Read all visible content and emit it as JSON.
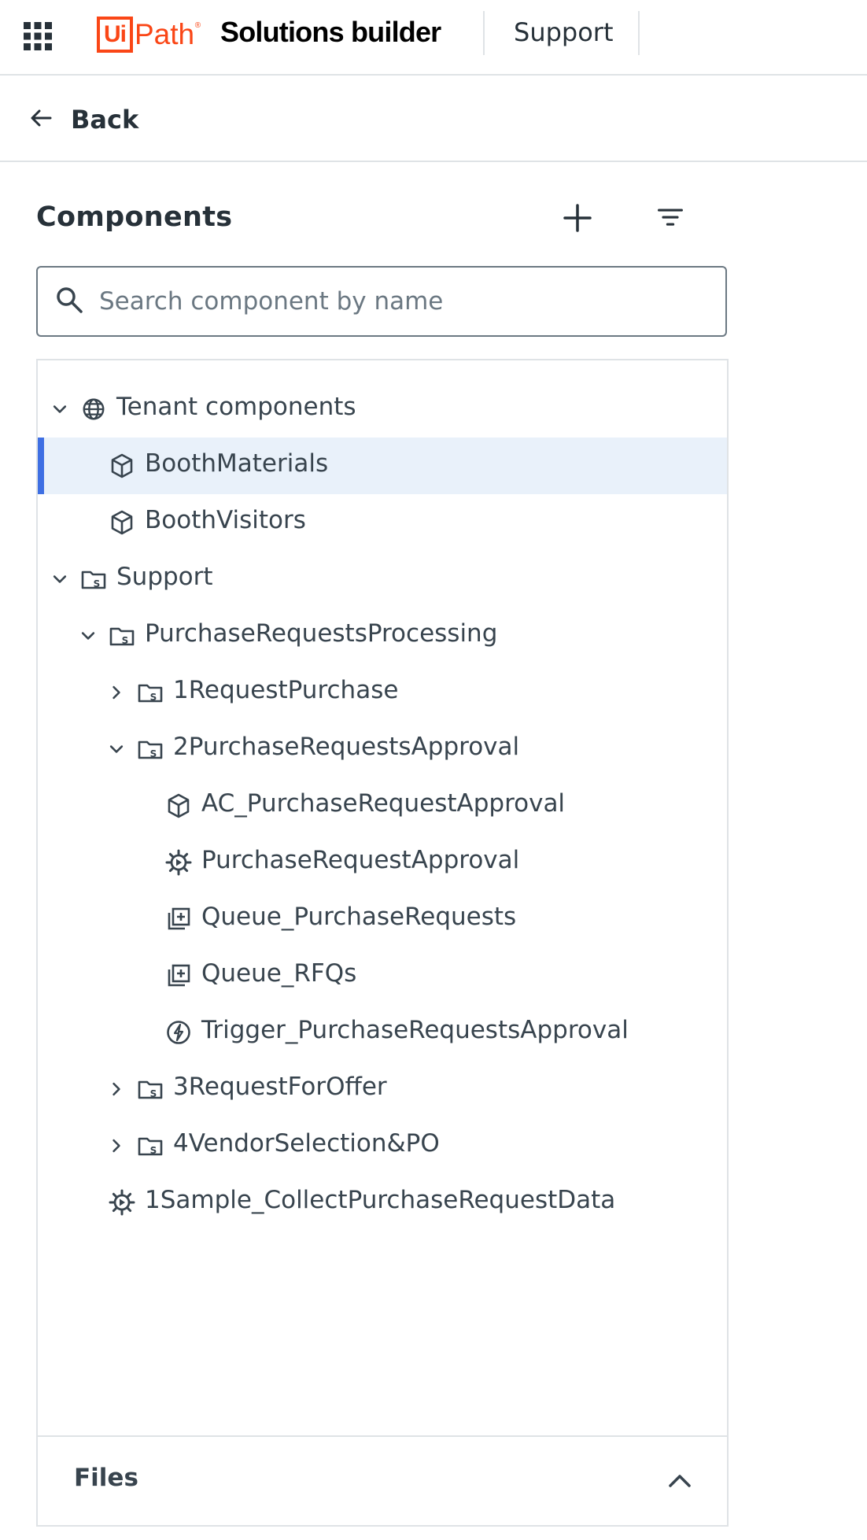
{
  "header": {
    "logo_mark": "Ui",
    "logo_word": "Path",
    "logo_reg": "®",
    "title": "Solutions builder",
    "context": "Support",
    "apps_icon": "apps-grid-icon"
  },
  "nav": {
    "back_label": "Back",
    "back_icon": "arrow-left-icon"
  },
  "panel": {
    "title": "Components",
    "add_icon": "plus-icon",
    "filter_icon": "filter-icon",
    "search": {
      "placeholder": "Search component by name",
      "value": "",
      "icon": "search-icon"
    }
  },
  "tree": [
    {
      "label": "Tenant components",
      "icon": "globe-icon",
      "chevron": "down",
      "level": 0
    },
    {
      "label": "BoothMaterials",
      "icon": "cube-icon",
      "chevron": "none",
      "level": 1,
      "selected": true
    },
    {
      "label": "BoothVisitors",
      "icon": "cube-icon",
      "chevron": "none",
      "level": 1
    },
    {
      "label": "Support",
      "icon": "solution-folder-icon",
      "chevron": "down",
      "level": 0
    },
    {
      "label": "PurchaseRequestsProcessing",
      "icon": "solution-folder-icon",
      "chevron": "down",
      "level": 1
    },
    {
      "label": "1RequestPurchase",
      "icon": "solution-folder-icon",
      "chevron": "right",
      "level": 2
    },
    {
      "label": "2PurchaseRequestsApproval",
      "icon": "solution-folder-icon",
      "chevron": "down",
      "level": 2
    },
    {
      "label": "AC_PurchaseRequestApproval",
      "icon": "cube-icon",
      "chevron": "none",
      "level": 3
    },
    {
      "label": "PurchaseRequestApproval",
      "icon": "process-gear-icon",
      "chevron": "none",
      "level": 3
    },
    {
      "label": "Queue_PurchaseRequests",
      "icon": "queue-icon",
      "chevron": "none",
      "level": 3
    },
    {
      "label": "Queue_RFQs",
      "icon": "queue-icon",
      "chevron": "none",
      "level": 3
    },
    {
      "label": "Trigger_PurchaseRequestsApproval",
      "icon": "trigger-bolt-icon",
      "chevron": "none",
      "level": 3
    },
    {
      "label": "3RequestForOffer",
      "icon": "solution-folder-icon",
      "chevron": "right",
      "level": 2
    },
    {
      "label": "4VendorSelection&PO",
      "icon": "solution-folder-icon",
      "chevron": "right",
      "level": 2
    },
    {
      "label": "1Sample_CollectPurchaseRequestData",
      "icon": "process-gear-icon",
      "chevron": "none",
      "level": 1
    }
  ],
  "files": {
    "label": "Files",
    "icon": "chevron-up-icon"
  },
  "colors": {
    "brand": "#fa4616",
    "selected_bg": "#e9f1fa",
    "selected_accent": "#3e6fe3",
    "text": "#273139",
    "border": "#dfe3e6"
  }
}
